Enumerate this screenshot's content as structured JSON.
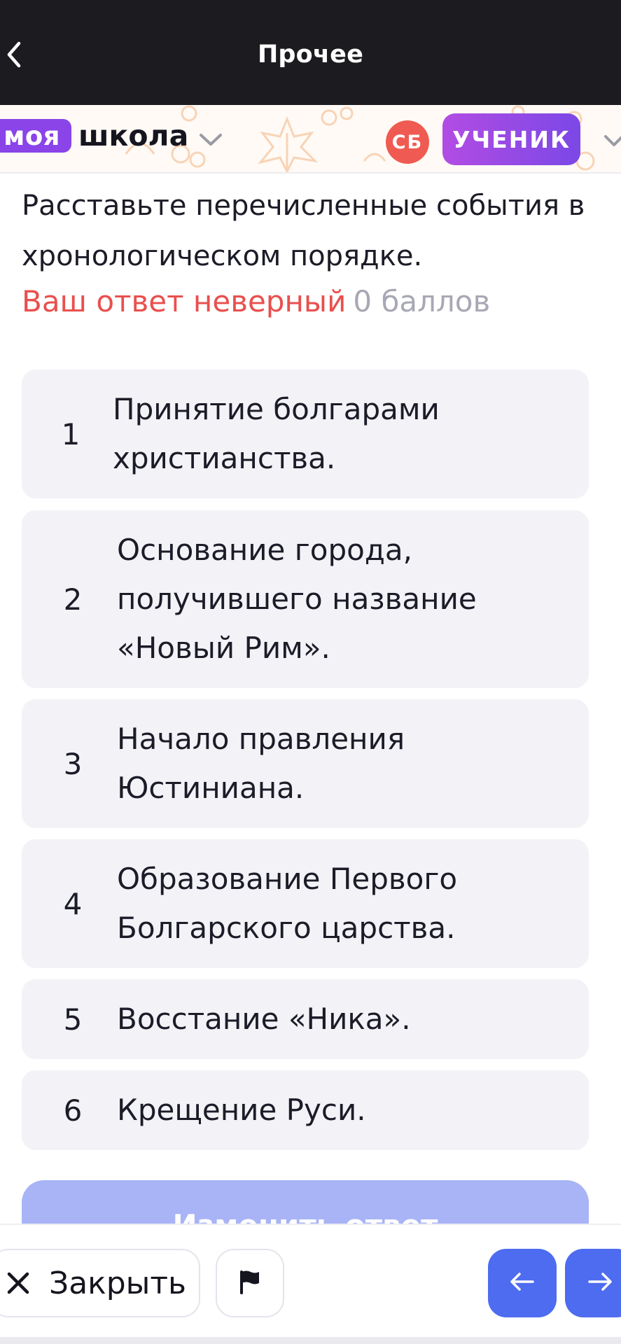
{
  "topbar": {
    "title": "Прочее"
  },
  "school": {
    "logo_part1": "моя",
    "logo_part2": "школа",
    "avatar_initials": "СБ",
    "role": "УЧЕНИК"
  },
  "question": {
    "text": "Расставьте перечисленные события в хронологическом порядке.",
    "result_status": "Ваш ответ неверный",
    "score": "0 баллов"
  },
  "answers": [
    {
      "num": "1",
      "text": "Принятие болгарами христианства."
    },
    {
      "num": "2",
      "text": "Основание города, получившего название «Новый Рим»."
    },
    {
      "num": "3",
      "text": "Начало правления Юстиниана."
    },
    {
      "num": "4",
      "text": "Образование Первого Болгарского царства."
    },
    {
      "num": "5",
      "text": "Восстание «Ника»."
    },
    {
      "num": "6",
      "text": "Крещение Руси."
    }
  ],
  "change_answer_label": "Изменить ответ",
  "bottom": {
    "close_label": "Закрыть"
  },
  "icons": {
    "back": "chevron-left-icon",
    "close": "close-icon",
    "flag": "flag-icon",
    "prev": "arrow-left-icon",
    "next": "arrow-right-icon"
  },
  "colors": {
    "wrong": "#e8504e",
    "accent": "#4d6cf0",
    "role_badge": "#8a44e8",
    "avatar": "#ef5b52"
  }
}
